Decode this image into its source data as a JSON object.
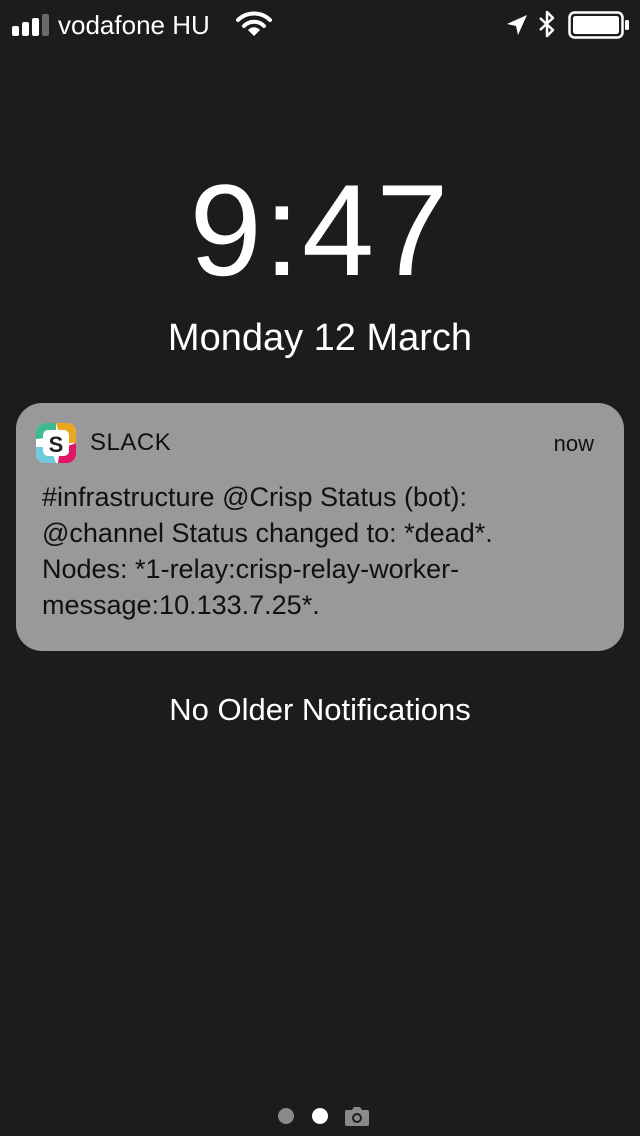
{
  "status_bar": {
    "carrier": "vodafone HU",
    "signal_icon": "signal-bars-icon",
    "wifi_icon": "wifi-icon",
    "location_icon": "location-arrow-icon",
    "bluetooth_icon": "bluetooth-icon",
    "battery_icon": "battery-icon"
  },
  "lockscreen": {
    "time": "9:47",
    "date": "Monday 12 March",
    "no_older_notifications": "No Older Notifications"
  },
  "notification": {
    "app_name": "SLACK",
    "time": "now",
    "app_icon": "slack-app-icon",
    "body_lines": [
      "#infrastructure @Crisp Status (bot):",
      "@channel Status changed to: *dead*.",
      "Nodes: *1-relay:crisp-relay-worker-",
      "message:10.133.7.25*."
    ],
    "colors": {
      "background": "#999999",
      "text": "#111111"
    }
  },
  "page_indicator": {
    "pages": 2,
    "active_page": 2,
    "camera_icon": "camera-icon"
  },
  "colors": {
    "background": "#1c1c1c",
    "text": "#ffffff"
  }
}
